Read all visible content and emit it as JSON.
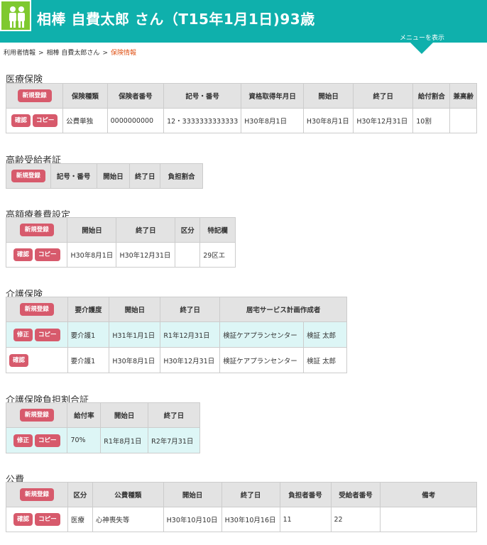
{
  "header": {
    "title": "相棒 自費太郎 さん（T15年1月1日)93歳",
    "menu_label": "メニューを表示",
    "accent": "#0fb0ac",
    "avatar_bg": "#7fc92f"
  },
  "breadcrumb": {
    "items": [
      "利用者情報",
      "相棒 自費太郎さん",
      "保険情報"
    ],
    "separator": ">"
  },
  "buttons": {
    "new": "新規登録",
    "confirm": "確認",
    "copy": "コピー",
    "edit": "修正",
    "color": "#d75a6c"
  },
  "medical": {
    "title": "医療保険",
    "headers": [
      "保険種類",
      "保険者番号",
      "記号・番号",
      "資格取得年月日",
      "開始日",
      "終了日",
      "給付割合",
      "兼高齢"
    ],
    "rows": [
      [
        "公費単独",
        "0000000000",
        "12・3333333333333",
        "H30年8月1日",
        "H30年8月1日",
        "H30年12月31日",
        "10割",
        ""
      ]
    ]
  },
  "elderly": {
    "title": "高齢受給者証",
    "headers": [
      "記号・番号",
      "開始日",
      "終了日",
      "負担割合"
    ]
  },
  "high_cost": {
    "title": "高額療養費設定",
    "headers": [
      "開始日",
      "終了日",
      "区分",
      "特記欄"
    ],
    "rows": [
      [
        "H30年8月1日",
        "H30年12月31日",
        "",
        "29区エ"
      ]
    ]
  },
  "care": {
    "title": "介護保険",
    "headers": [
      "要介護度",
      "開始日",
      "終了日",
      "居宅サービス計画作成者"
    ],
    "rows": [
      [
        "要介護1",
        "H31年1月1日",
        "R1年12月31日",
        "検証ケアプランセンター",
        "検証  太郎"
      ],
      [
        "要介護1",
        "H30年8月1日",
        "H30年12月31日",
        "検証ケアプランセンター",
        "検証  太郎"
      ]
    ]
  },
  "care_burden": {
    "title": "介護保険負担割合証",
    "headers": [
      "給付率",
      "開始日",
      "終了日"
    ],
    "rows": [
      [
        "70%",
        "R1年8月1日",
        "R2年7月31日"
      ]
    ]
  },
  "public": {
    "title": "公費",
    "headers": [
      "区分",
      "公費種類",
      "開始日",
      "終了日",
      "負担者番号",
      "受給者番号",
      "備考"
    ],
    "rows": [
      [
        "医療",
        "心神喪失等",
        "H30年10月10日",
        "H30年10月16日",
        "11",
        "22",
        ""
      ]
    ]
  }
}
